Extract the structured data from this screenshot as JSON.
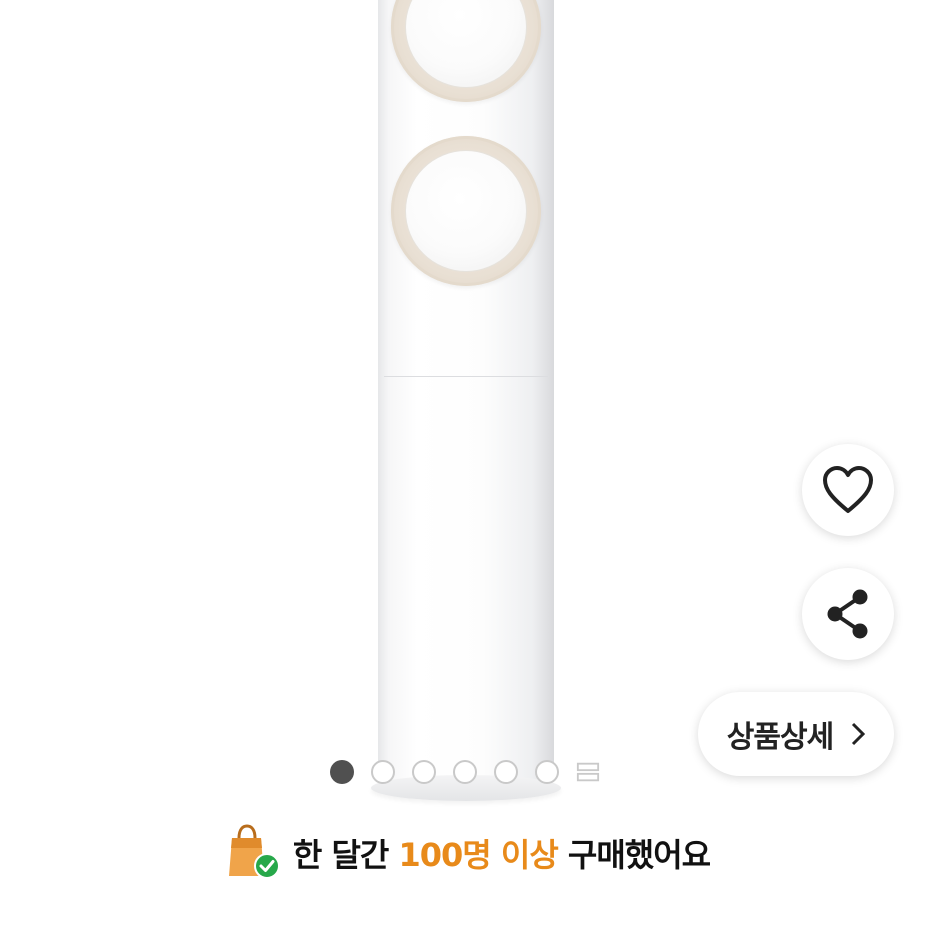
{
  "pagination": {
    "total_dots": 6,
    "active_index": 0,
    "more_icon": "grid-more-icon"
  },
  "actions": {
    "like_icon": "heart-icon",
    "share_icon": "share-icon",
    "detail_label": "상품상세",
    "detail_icon": "chevron-right-icon"
  },
  "banner": {
    "icon": "shopping-bag-check-icon",
    "prefix": "한 달간 ",
    "highlight": "100명 이상",
    "suffix": " 구매했어요",
    "highlight_color": "#e88a1a"
  }
}
